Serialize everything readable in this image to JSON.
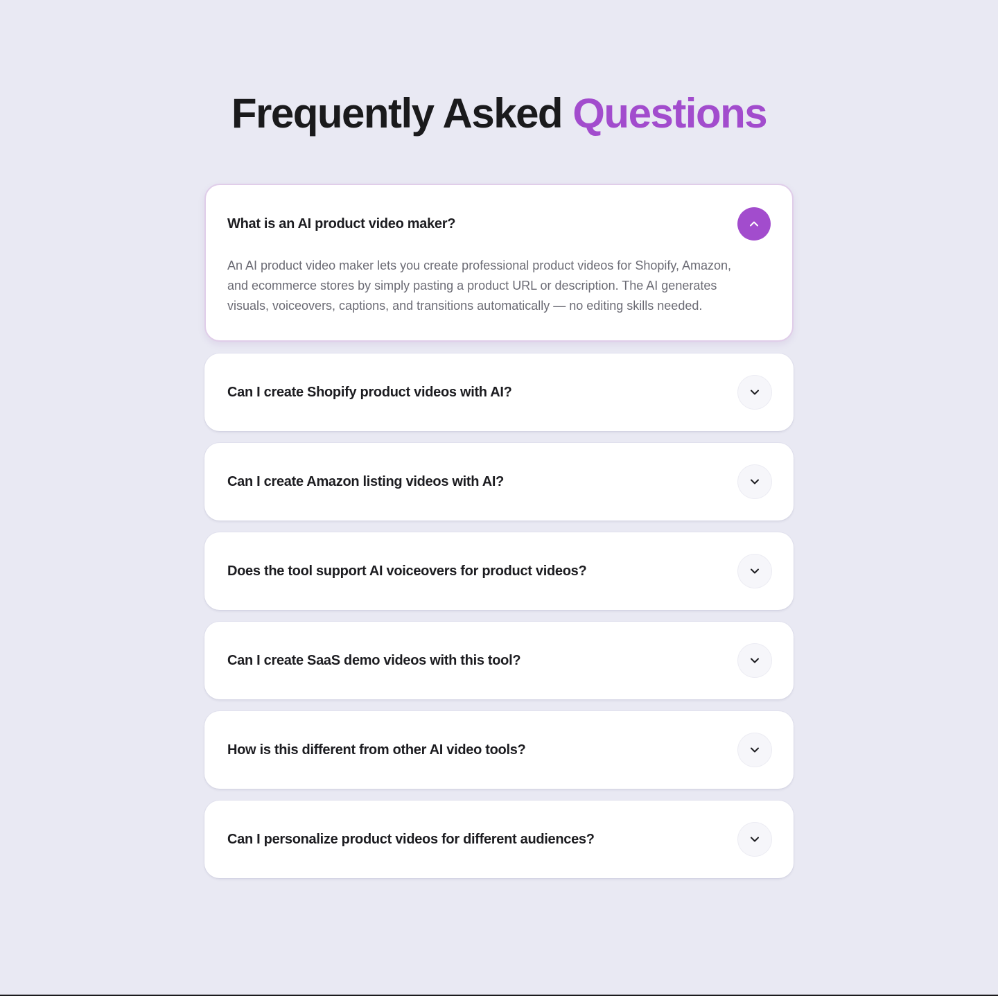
{
  "heading": {
    "main": "Frequently Asked",
    "accent": "Questions"
  },
  "colors": {
    "accent": "#a24ccd",
    "background": "#e9e9f3",
    "card": "#ffffff",
    "text": "#1c1c20",
    "muted_text": "#6b6b74"
  },
  "faq": {
    "items": [
      {
        "question": "What is an AI product video maker?",
        "answer": "An AI product video maker lets you create professional product videos for Shopify, Amazon, and ecommerce stores by simply pasting a product URL or description. The AI generates visuals, voiceovers, captions, and transitions automatically — no editing skills needed.",
        "expanded": true,
        "icon": "chevron-up-icon"
      },
      {
        "question": "Can I create Shopify product videos with AI?",
        "expanded": false,
        "icon": "chevron-down-icon"
      },
      {
        "question": "Can I create Amazon listing videos with AI?",
        "expanded": false,
        "icon": "chevron-down-icon"
      },
      {
        "question": "Does the tool support AI voiceovers for product videos?",
        "expanded": false,
        "icon": "chevron-down-icon"
      },
      {
        "question": "Can I create SaaS demo videos with this tool?",
        "expanded": false,
        "icon": "chevron-down-icon"
      },
      {
        "question": "How is this different from other AI video tools?",
        "expanded": false,
        "icon": "chevron-down-icon"
      },
      {
        "question": "Can I personalize product videos for different audiences?",
        "expanded": false,
        "icon": "chevron-down-icon"
      }
    ]
  }
}
